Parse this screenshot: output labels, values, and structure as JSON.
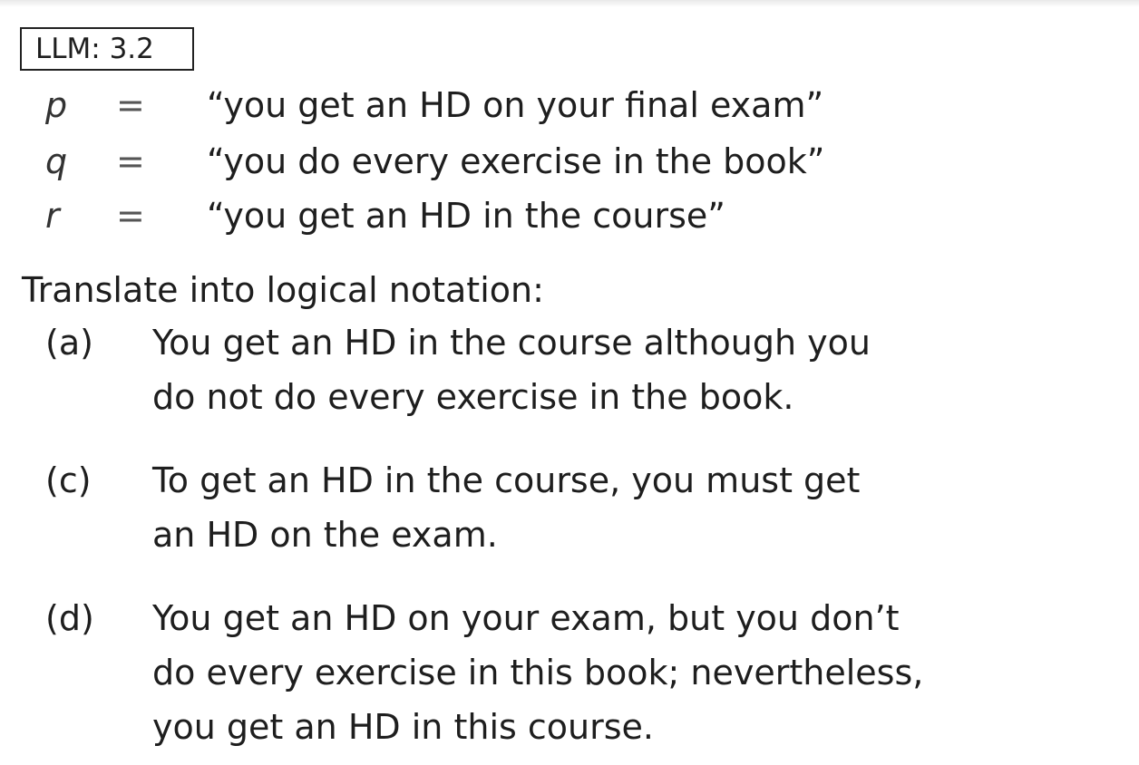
{
  "header": {
    "tag": "LLM: 3.2"
  },
  "definitions": [
    {
      "var": "p",
      "eq": "=",
      "text": "“you get an HD on your final exam”"
    },
    {
      "var": "q",
      "eq": "=",
      "text": "“you do every exercise in the book”"
    },
    {
      "var": "r",
      "eq": "=",
      "text": "“you get an HD in the course”"
    }
  ],
  "prompt": "Translate into logical notation:",
  "items": [
    {
      "label": "(a)",
      "lines": [
        "You get an HD in the course although you",
        "do not do every exercise in the book."
      ]
    },
    {
      "label": "(c)",
      "lines": [
        "To get an HD in the course, you must get",
        "an HD on the exam."
      ]
    },
    {
      "label": "(d)",
      "lines": [
        "You get an HD on your exam, but you don’t",
        "do every exercise in this book; nevertheless,",
        "you get an HD in this course."
      ]
    }
  ]
}
